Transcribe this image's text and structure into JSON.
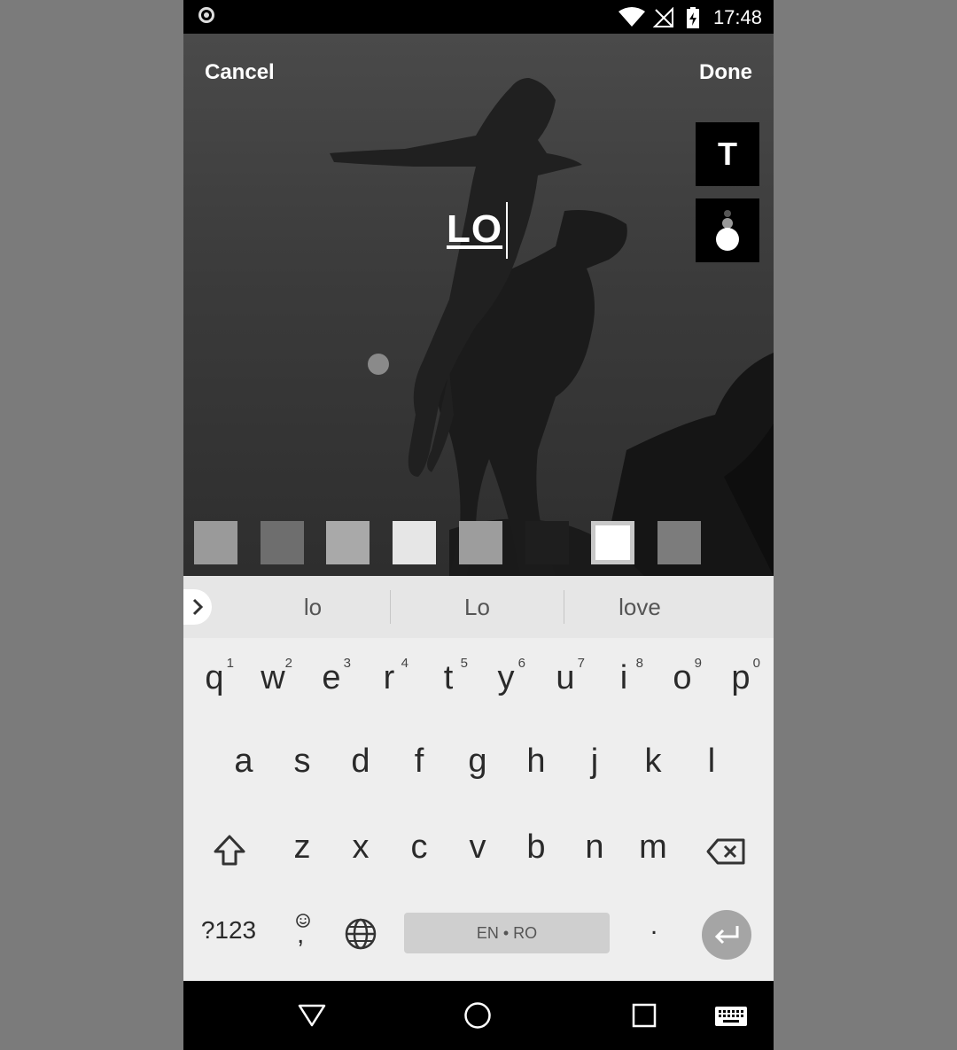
{
  "status_bar": {
    "time": "17:48",
    "icons": [
      "circle-notification-icon",
      "wifi-icon",
      "no-signal-icon",
      "battery-charging-icon"
    ]
  },
  "editor": {
    "cancel_label": "Cancel",
    "done_label": "Done",
    "text_tool_label": "T",
    "overlay_text": "LO",
    "swatch_colors": [
      "#9a9a9a",
      "#6e6e6e",
      "#a9a9a9",
      "#e6e6e6",
      "#9d9d9d",
      "#1e1e1e",
      "#f2f2f2",
      "#7c7c7c"
    ],
    "selected_swatch_index": 6
  },
  "keyboard": {
    "suggestions": [
      "lo",
      "Lo",
      "love"
    ],
    "row1": [
      {
        "char": "q",
        "hint": "1"
      },
      {
        "char": "w",
        "hint": "2"
      },
      {
        "char": "e",
        "hint": "3"
      },
      {
        "char": "r",
        "hint": "4"
      },
      {
        "char": "t",
        "hint": "5"
      },
      {
        "char": "y",
        "hint": "6"
      },
      {
        "char": "u",
        "hint": "7"
      },
      {
        "char": "i",
        "hint": "8"
      },
      {
        "char": "o",
        "hint": "9"
      },
      {
        "char": "p",
        "hint": "0"
      }
    ],
    "row2": [
      "a",
      "s",
      "d",
      "f",
      "g",
      "h",
      "j",
      "k",
      "l"
    ],
    "row3": [
      "z",
      "x",
      "c",
      "v",
      "b",
      "n",
      "m"
    ],
    "symbols_label": "?123",
    "comma_label": ",",
    "space_label": "EN • RO",
    "period_label": "."
  }
}
